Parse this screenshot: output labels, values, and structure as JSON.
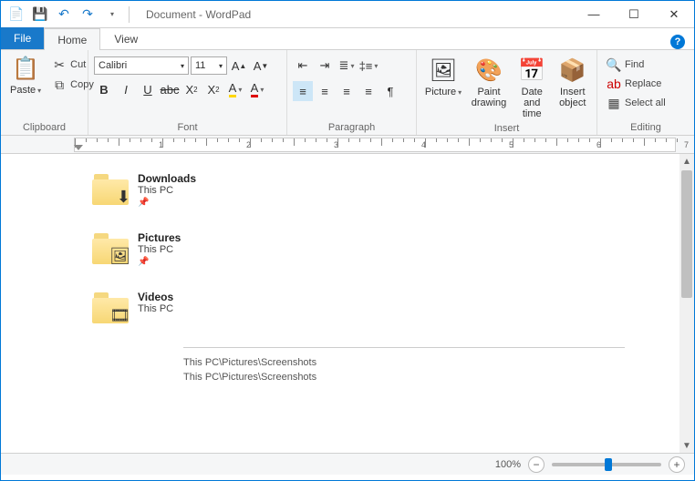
{
  "titlebar": {
    "title": "Document - WordPad"
  },
  "tabs": {
    "file": "File",
    "home": "Home",
    "view": "View"
  },
  "ribbon": {
    "clipboard": {
      "label": "Clipboard",
      "paste": "Paste",
      "cut": "Cut",
      "copy": "Copy"
    },
    "font": {
      "label": "Font",
      "name": "Calibri",
      "size": "11"
    },
    "paragraph": {
      "label": "Paragraph"
    },
    "insert": {
      "label": "Insert",
      "picture": "Picture",
      "paint": "Paint drawing",
      "datetime": "Date and time",
      "object": "Insert object"
    },
    "editing": {
      "label": "Editing",
      "find": "Find",
      "replace": "Replace",
      "selectall": "Select all"
    }
  },
  "ruler": {
    "marks": [
      "1",
      "2",
      "3",
      "4",
      "5",
      "6",
      "7"
    ]
  },
  "document": {
    "items": [
      {
        "name": "Downloads",
        "location": "This PC",
        "pinned": true,
        "overlay": "arrow"
      },
      {
        "name": "Pictures",
        "location": "This PC",
        "pinned": true,
        "overlay": "photo"
      },
      {
        "name": "Videos",
        "location": "This PC",
        "pinned": false,
        "overlay": "film"
      }
    ],
    "paths": [
      "This PC\\Pictures\\Screenshots",
      "This PC\\Pictures\\Screenshots"
    ]
  },
  "statusbar": {
    "zoom": "100%"
  }
}
